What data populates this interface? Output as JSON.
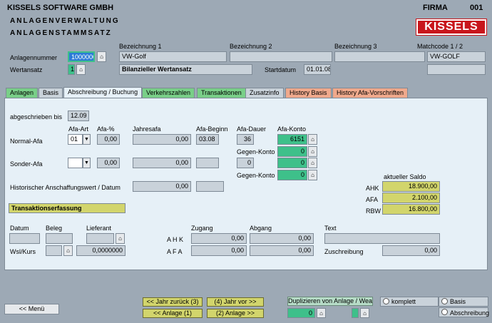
{
  "header": {
    "company": "KISSELS SOFTWARE GMBH",
    "module1": "ANLAGENVERWALTUNG",
    "module2": "ANLAGENSTAMMSATZ",
    "firma_label": "FIRMA",
    "firma_value": "001",
    "logo_text": "KISSELS"
  },
  "master": {
    "anlagennummer_label": "Anlagennummer",
    "anlagennummer": "1000000",
    "wertansatz_label": "Wertansatz",
    "wertansatz": "1",
    "bez1_label": "Bezeichnung 1",
    "bez1": "VW-Golf",
    "bez2_label": "Bezeichnung 2",
    "bez2": "",
    "bez3_label": "Bezeichnung 3",
    "bez3": "",
    "matchcode_label": "Matchcode 1 / 2",
    "matchcode1": "VW-GOLF",
    "matchcode2": "",
    "wertansatz_text": "Bilanzieller Wertansatz",
    "startdatum_label": "Startdatum",
    "startdatum": "01.01.08"
  },
  "tabs": [
    {
      "label": "Anlagen",
      "color": "g"
    },
    {
      "label": "Basis",
      "color": ""
    },
    {
      "label": "Abschreibung / Buchung",
      "color": "a"
    },
    {
      "label": "Verkehrszahlen",
      "color": "g"
    },
    {
      "label": "Transaktionen",
      "color": "g"
    },
    {
      "label": "Zusatzinfo",
      "color": ""
    },
    {
      "label": "History Basis",
      "color": "p"
    },
    {
      "label": "History Afa-Vorschriften",
      "color": "p"
    }
  ],
  "afa": {
    "abgeschrieben_label": "abgeschrieben bis",
    "abgeschrieben": "12.09",
    "col_afa_art": "Afa-Art",
    "col_afa_pct": "Afa-%",
    "col_jahresafa": "Jahresafa",
    "col_afa_beginn": "Afa-Beginn",
    "col_afa_dauer": "Afa-Dauer",
    "col_afa_konto": "Afa-Konto",
    "normal_label": "Normal-Afa",
    "normal_art": "01",
    "normal_pct": "0,00",
    "normal_jahresafa": "0,00",
    "normal_beginn": "03.08",
    "normal_dauer": "36",
    "normal_konto": "6151",
    "gegen_label1": "Gegen-Konto",
    "gegen_konto1": "0",
    "sonder_label": "Sonder-Afa",
    "sonder_art": "",
    "sonder_pct": "0,00",
    "sonder_jahresafa": "0,00",
    "sonder_beginn": "",
    "sonder_dauer": "0",
    "sonder_konto": "0",
    "gegen_label2": "Gegen-Konto",
    "gegen_konto2": "0",
    "hist_label": "Historischer  Anschaffungswert / Datum",
    "hist_wert": "0,00",
    "hist_datum": "",
    "saldo_label": "aktueller Saldo",
    "ahk_label": "AHK",
    "ahk": "18.900,00",
    "afa_label": "AFA",
    "afa_value": "2.100,00",
    "rbw_label": "RBW",
    "rbw": "16.800,00"
  },
  "trans": {
    "title": "Transaktionserfassung",
    "datum_label": "Datum",
    "beleg_label": "Beleg",
    "lieferant_label": "Lieferant",
    "zugang_label": "Zugang",
    "abgang_label": "Abgang",
    "text_label": "Text",
    "wsl_label": "Wsl/Kurs",
    "kurs": "0,0000000",
    "ahk_label": "A H K",
    "afa_label": "A F A",
    "zugang_ahk": "0,00",
    "abgang_ahk": "0,00",
    "zugang_afa": "0,00",
    "abgang_afa": "0,00",
    "zuschreibung_label": "Zuschreibung",
    "zuschreibung": "0,00"
  },
  "footer": {
    "menu": "<<  Menü",
    "jahr_zurueck": "<< Jahr zurück (3)",
    "jahr_vor": "(4) Jahr vor >>",
    "anlage_zurueck": "<< Anlage (1)",
    "anlage_vor": "(2) Anlage >>",
    "duplizieren": "Duplizieren von Anlage / Wea",
    "dup_anlage": "0",
    "dup_wea": "",
    "opt_komplett": "komplett",
    "opt_basis": "Basis",
    "opt_abschreibung": "Abschreibung"
  }
}
